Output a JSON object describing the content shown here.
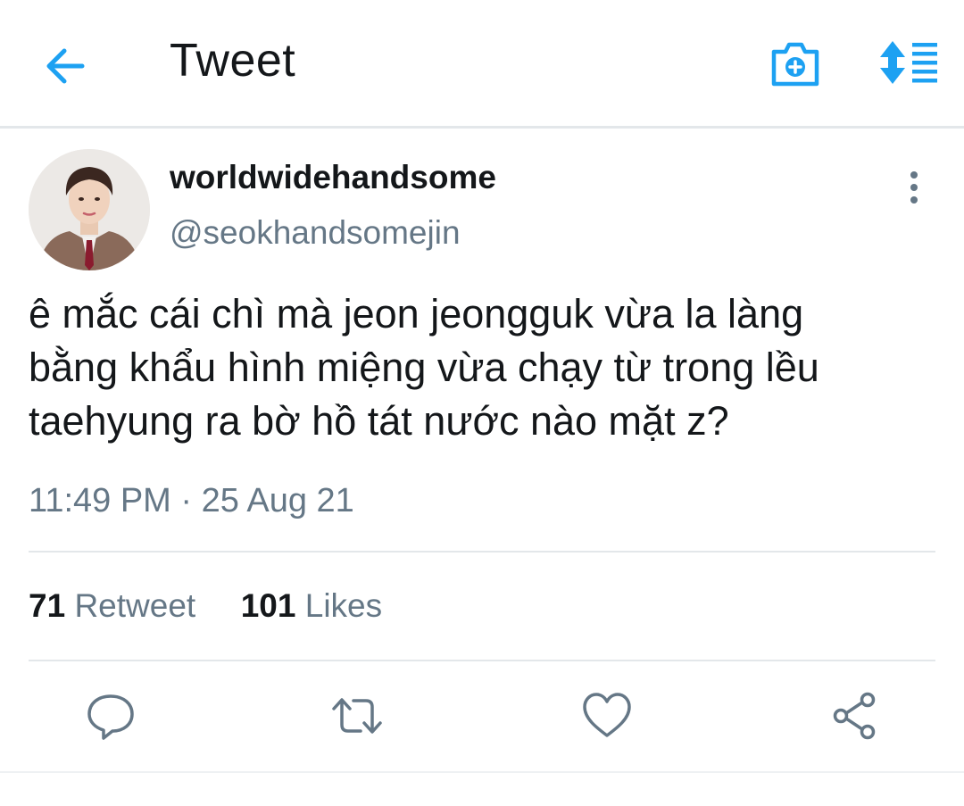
{
  "header": {
    "title": "Tweet",
    "back_icon": "arrow-left-icon",
    "camera_icon": "camera-plus-icon",
    "sort_icon": "sort-list-icon",
    "accent": "#1da1f2"
  },
  "tweet": {
    "display_name": "worldwidehandsome",
    "handle": "@seokhandsomejin",
    "text": "ê mắc cái chì mà jeon jeongguk vừa la làng\nbằng khẩu hình miệng vừa chạy từ trong lều\ntaehyung ra bờ hồ tát nước nào mặt z?",
    "time": "11:49 PM",
    "separator": "·",
    "date": "25 Aug 21",
    "more_icon": "more-vertical-icon"
  },
  "stats": {
    "retweets_count": "71",
    "retweets_label": "Retweet",
    "likes_count": "101",
    "likes_label": "Likes"
  },
  "actions": [
    {
      "icon": "reply-icon"
    },
    {
      "icon": "retweet-icon"
    },
    {
      "icon": "heart-icon"
    },
    {
      "icon": "share-icon"
    }
  ],
  "colors": {
    "text_primary": "#14171a",
    "text_secondary": "#657786",
    "divider": "#e3e7ea"
  }
}
